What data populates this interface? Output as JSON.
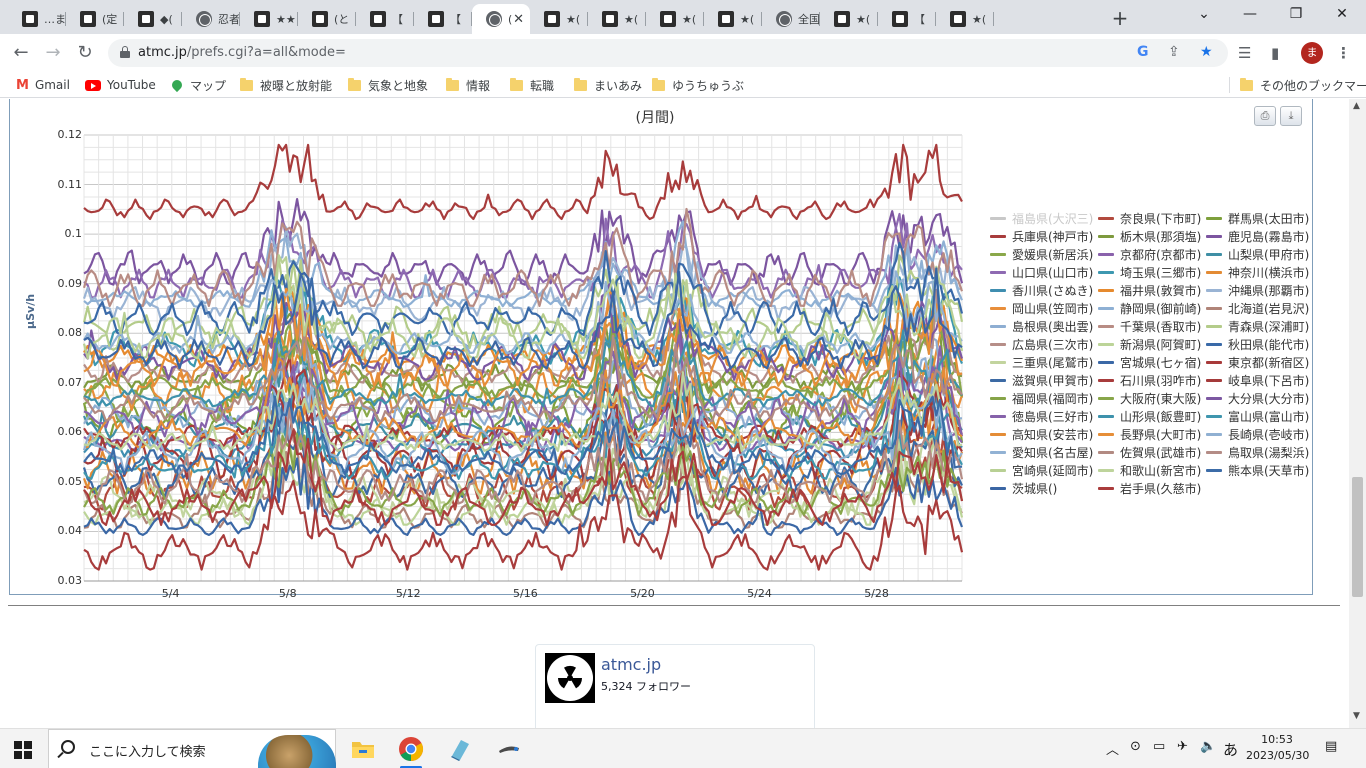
{
  "browser": {
    "tabs": [
      {
        "label": "…まぇ",
        "icon": "site-icon"
      },
      {
        "label": "(定",
        "icon": "site-icon"
      },
      {
        "label": "◆(",
        "icon": "site-icon"
      },
      {
        "label": "忍者",
        "icon": "globe-icon"
      },
      {
        "label": "★★",
        "icon": "site-icon"
      },
      {
        "label": "(と",
        "icon": "site-icon"
      },
      {
        "label": "【　ま",
        "icon": "site-icon"
      },
      {
        "label": "【　も",
        "icon": "site-icon"
      },
      {
        "label": "(",
        "icon": "globe-icon",
        "active": true
      },
      {
        "label": "★(",
        "icon": "site-icon"
      },
      {
        "label": "★(",
        "icon": "site-icon"
      },
      {
        "label": "★(",
        "icon": "site-icon"
      },
      {
        "label": "★(",
        "icon": "site-icon"
      },
      {
        "label": "全国",
        "icon": "globe-icon"
      },
      {
        "label": "★(",
        "icon": "site-icon"
      },
      {
        "label": "【　遺",
        "icon": "site-icon"
      },
      {
        "label": "★(",
        "icon": "site-icon"
      }
    ],
    "new_tab": "+",
    "url_host": "atmc.jp",
    "url_path": "/prefs.cgi?a=all&mode=",
    "profile_initial": "ま"
  },
  "bookmarks": [
    {
      "label": "Gmail",
      "icon": "gmail-icon"
    },
    {
      "label": "YouTube",
      "icon": "youtube-icon"
    },
    {
      "label": "マップ",
      "icon": "maps-icon"
    },
    {
      "label": "被曝と放射能",
      "icon": "folder-icon"
    },
    {
      "label": "気象と地象",
      "icon": "folder-icon"
    },
    {
      "label": "情報",
      "icon": "folder-icon"
    },
    {
      "label": "転職",
      "icon": "folder-icon"
    },
    {
      "label": "まいあみ",
      "icon": "folder-icon"
    },
    {
      "label": "ゆうちゅうぶ",
      "icon": "folder-icon"
    }
  ],
  "other_bookmarks": "その他のブックマーク",
  "chart_data": {
    "type": "line",
    "title": "(月間)",
    "ylabel": "μSv/h",
    "xlabel": "",
    "ylim": [
      0.03,
      0.12
    ],
    "yticks": [
      "0.12",
      "0.11",
      "0.1",
      "0.09",
      "0.08",
      "0.07",
      "0.06",
      "0.05",
      "0.04",
      "0.03"
    ],
    "xticks": [
      "5/4",
      "5/8",
      "5/12",
      "5/16",
      "5/20",
      "5/24",
      "5/28"
    ],
    "grid": true,
    "legend_position": "right",
    "series": [
      {
        "name": "福島県(大沢三)",
        "color": "#c8c8c8",
        "hidden": true,
        "base": 0.0
      },
      {
        "name": "奈良県(下市町)",
        "color": "#b24a3e",
        "base": 0.048
      },
      {
        "name": "群馬県(太田市)",
        "color": "#7ea03c",
        "base": 0.062
      },
      {
        "name": "兵庫県(神戸市)",
        "color": "#a83c3c",
        "base": 0.105
      },
      {
        "name": "栃木県(那須塩)",
        "color": "#7e9a3e",
        "base": 0.071
      },
      {
        "name": "鹿児島(霧島市)",
        "color": "#7c55a0",
        "base": 0.093
      },
      {
        "name": "愛媛県(新居浜)",
        "color": "#8aa84a",
        "base": 0.066
      },
      {
        "name": "京都府(京都市)",
        "color": "#8a62ac",
        "base": 0.058
      },
      {
        "name": "山梨県(甲府市)",
        "color": "#3f8fa5",
        "base": 0.061
      },
      {
        "name": "山口県(山口市)",
        "color": "#8e6ab2",
        "base": 0.09
      },
      {
        "name": "埼玉県(三郷市)",
        "color": "#3d98b0",
        "base": 0.077
      },
      {
        "name": "神奈川(横浜市)",
        "color": "#e38b34",
        "base": 0.052
      },
      {
        "name": "香川県(さぬき)",
        "color": "#3f8eb0",
        "base": 0.057
      },
      {
        "name": "福井県(敦賀市)",
        "color": "#e68a2e",
        "base": 0.075
      },
      {
        "name": "沖縄県(那覇市)",
        "color": "#9ab4d4",
        "base": 0.086
      },
      {
        "name": "岡山県(笠岡市)",
        "color": "#e88e3a",
        "base": 0.068
      },
      {
        "name": "静岡県(御前崎)",
        "color": "#8eb0d4",
        "base": 0.087
      },
      {
        "name": "北海道(岩見沢)",
        "color": "#b08478",
        "base": 0.043
      },
      {
        "name": "島根県(奥出雲)",
        "color": "#8eaed2",
        "base": 0.064
      },
      {
        "name": "千葉県(香取市)",
        "color": "#b88c84",
        "base": 0.089
      },
      {
        "name": "青森県(深浦町)",
        "color": "#b4cc8a",
        "base": 0.081
      },
      {
        "name": "広島県(三次市)",
        "color": "#b68e88",
        "base": 0.072
      },
      {
        "name": "新潟県(阿賀町)",
        "color": "#bcd498",
        "base": 0.044
      },
      {
        "name": "秋田県(能代市)",
        "color": "#3a6aa8",
        "base": 0.083
      },
      {
        "name": "三重県(尾鷲市)",
        "color": "#c2d49e",
        "base": 0.047
      },
      {
        "name": "宮城県(七ヶ宿)",
        "color": "#3b68a6",
        "base": 0.041
      },
      {
        "name": "東京都(新宿区)",
        "color": "#a83a3a",
        "base": 0.059
      },
      {
        "name": "滋賀県(甲賀市)",
        "color": "#3c6aa4",
        "base": 0.05
      },
      {
        "name": "石川県(羽咋市)",
        "color": "#a83c3c",
        "base": 0.036
      },
      {
        "name": "岐阜県(下呂市)",
        "color": "#a43a3a",
        "base": 0.055
      },
      {
        "name": "福岡県(福岡市)",
        "color": "#86a448",
        "base": 0.069
      },
      {
        "name": "大阪府(東大阪)",
        "color": "#88a64a",
        "base": 0.046
      },
      {
        "name": "大分県(大分市)",
        "color": "#7c58a2",
        "base": 0.074
      },
      {
        "name": "徳島県(三好市)",
        "color": "#8662aa",
        "base": 0.063
      },
      {
        "name": "山形県(飯豊町)",
        "color": "#3e92ac",
        "base": 0.067
      },
      {
        "name": "富山県(富山市)",
        "color": "#3f96ae",
        "base": 0.053
      },
      {
        "name": "高知県(安芸市)",
        "color": "#e48c36",
        "base": 0.06
      },
      {
        "name": "長野県(大町市)",
        "color": "#e68e38",
        "base": 0.073
      },
      {
        "name": "長崎県(壱岐市)",
        "color": "#90b0d2",
        "base": 0.056
      },
      {
        "name": "愛知県(名古屋)",
        "color": "#92b2d4",
        "base": 0.078
      },
      {
        "name": "佐賀県(武雄市)",
        "color": "#b28a82",
        "base": 0.065
      },
      {
        "name": "鳥取県(湯梨浜)",
        "color": "#b48c86",
        "base": 0.049
      },
      {
        "name": "宮崎県(延岡市)",
        "color": "#b8d094",
        "base": 0.079
      },
      {
        "name": "和歌山(新宮市)",
        "color": "#bed49c",
        "base": 0.058
      },
      {
        "name": "熊本県(天草市)",
        "color": "#3c6ca8",
        "base": 0.054
      },
      {
        "name": "茨城県()",
        "color": "#3a66a4",
        "base": 0.076
      },
      {
        "name": "岩手県(久慈市)",
        "color": "#aa3c3c",
        "base": 0.045
      }
    ]
  },
  "chart_buttons": [
    {
      "icon": "print-icon"
    },
    {
      "icon": "download-icon"
    }
  ],
  "widget": {
    "name": "atmc.jp",
    "followers": "5,324 フォロワー"
  },
  "taskbar": {
    "search_placeholder": "ここに入力して検索",
    "ime": "あ",
    "time": "10:53",
    "date": "2023/05/30"
  }
}
